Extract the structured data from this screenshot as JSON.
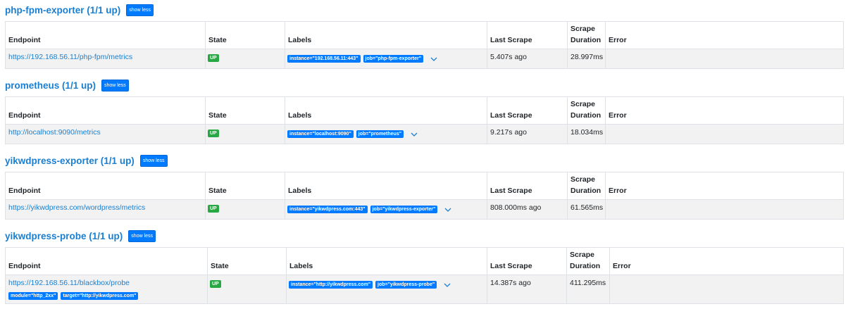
{
  "headers": {
    "endpoint": "Endpoint",
    "state": "State",
    "labels": "Labels",
    "last_scrape": "Last Scrape",
    "scrape_duration_1": "Scrape",
    "scrape_duration_2": "Duration",
    "error": "Error"
  },
  "pools": [
    {
      "title": "php-fpm-exporter (1/1 up)",
      "toggle": "show less",
      "target": {
        "endpoint": "https://192.168.56.11/php-fpm/metrics",
        "state": "UP",
        "labels": [
          "instance=\"192.168.56.11:443\"",
          "job=\"php-fpm-exporter\""
        ],
        "last_scrape": "5.407s ago",
        "scrape_duration": "28.997ms",
        "error": ""
      }
    },
    {
      "title": "prometheus (1/1 up)",
      "toggle": "show less",
      "target": {
        "endpoint": "http://localhost:9090/metrics",
        "state": "UP",
        "labels": [
          "instance=\"localhost:9090\"",
          "job=\"prometheus\""
        ],
        "last_scrape": "9.217s ago",
        "scrape_duration": "18.034ms",
        "error": ""
      }
    },
    {
      "title": "yikwdpress-exporter (1/1 up)",
      "toggle": "show less",
      "target": {
        "endpoint": "https://yikwdpress.com/wordpress/metrics",
        "state": "UP",
        "labels": [
          "instance=\"yikwdpress.com:443\"",
          "job=\"yikwdpress-exporter\""
        ],
        "last_scrape": "808.000ms ago",
        "scrape_duration": "61.565ms",
        "error": ""
      }
    },
    {
      "title": "yikwdpress-probe (1/1 up)",
      "toggle": "show less",
      "target": {
        "endpoint": "https://192.168.56.11/blackbox/probe",
        "endpoint_params": [
          "module=\"http_2xx\"",
          "target=\"http://yikwdpress.com\""
        ],
        "state": "UP",
        "labels": [
          "instance=\"http://yikwdpress.com\"",
          "job=\"yikwdpress-probe\""
        ],
        "last_scrape": "14.387s ago",
        "scrape_duration": "411.295ms",
        "error": ""
      }
    }
  ],
  "colors": {
    "link": "#1a7fd0",
    "badge_primary": "#007bff",
    "badge_success": "#28a745",
    "row_bg": "#f2f2f2",
    "border": "#dee2e6"
  },
  "icons": {
    "expand": "chevron-down-icon"
  }
}
